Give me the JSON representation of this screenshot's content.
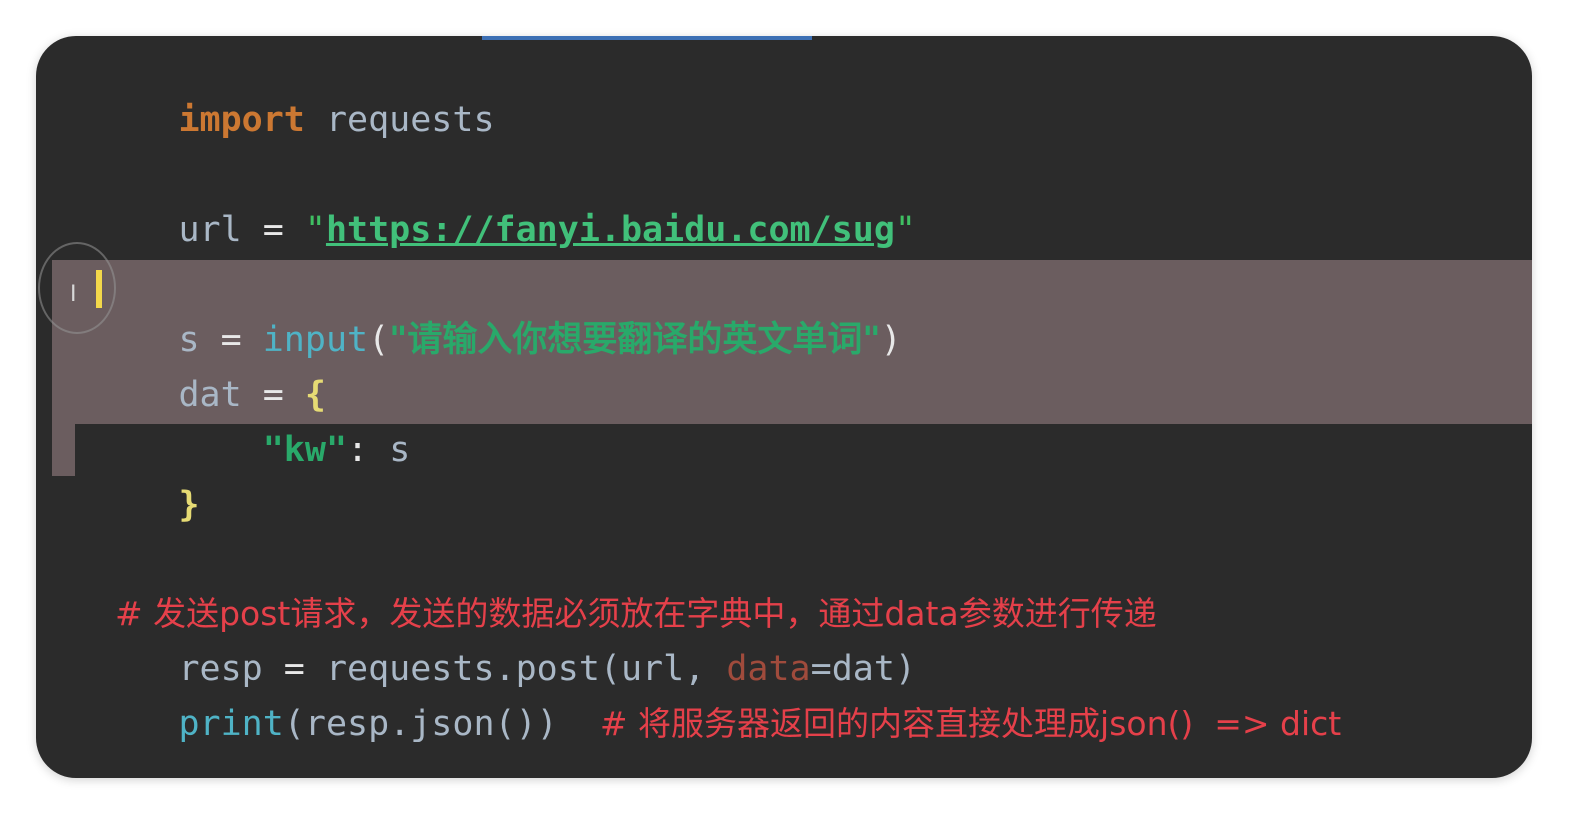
{
  "editor": {
    "lines": {
      "l1": {
        "keyword": "import",
        "space": " ",
        "module": "requests"
      },
      "l2": {
        "var": "url",
        "eq": " = ",
        "quote_open": "\"",
        "url": "https://fanyi.baidu.com/sug",
        "quote_close": "\""
      },
      "l3": {
        "var": "s",
        "eq": " = ",
        "func": "input",
        "paren_open": "(",
        "string": "\"请输入你想要翻译的英文单词\"",
        "paren_close": ")"
      },
      "l4": {
        "var": "dat",
        "eq": " = ",
        "brace": "{"
      },
      "l5": {
        "indent": "    ",
        "key": "\"kw\"",
        "colon": ": ",
        "value": "s"
      },
      "l6": {
        "brace": "}"
      },
      "l7": {
        "comment": "# 发送post请求，发送的数据必须放在字典中，通过data参数进行传递"
      },
      "l8": {
        "var": "resp",
        "eq": " = ",
        "call": "requests.post(url, ",
        "param": "data",
        "rest": "=dat)"
      },
      "l9": {
        "func": "print",
        "args": "(resp.json())",
        "gap": "  ",
        "comment": "# 将服务器返回的内容直接处理成json()  => dict"
      }
    }
  },
  "colors": {
    "background": "#2b2b2b",
    "selection": "#6b5d5f",
    "keyword": "#cc7832",
    "string": "#3fbf62",
    "comment": "#e5404a",
    "function": "#4fb3c6"
  }
}
